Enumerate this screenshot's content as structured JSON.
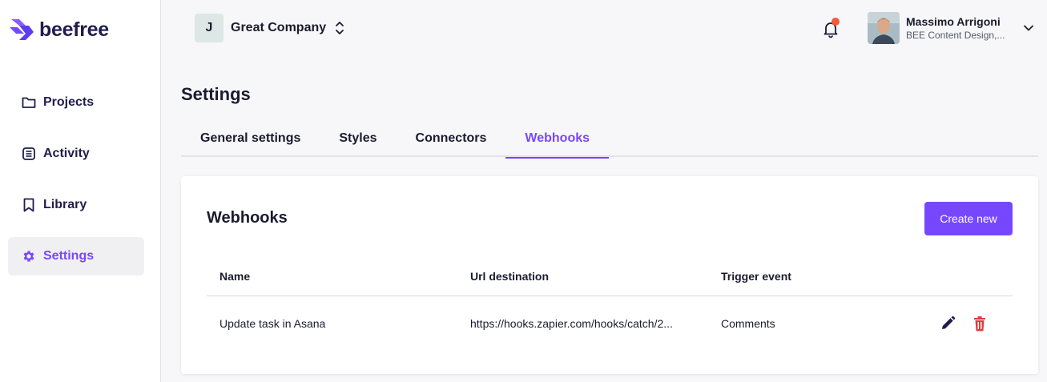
{
  "brand": {
    "name": "beefree"
  },
  "sidebar": {
    "items": [
      {
        "label": "Projects",
        "icon": "folder-icon",
        "active": false
      },
      {
        "label": "Activity",
        "icon": "activity-list-icon",
        "active": false
      },
      {
        "label": "Library",
        "icon": "bookmark-icon",
        "active": false
      },
      {
        "label": "Settings",
        "icon": "gear-icon",
        "active": true
      }
    ]
  },
  "header": {
    "company": {
      "initial": "J",
      "name": "Great Company"
    },
    "notifications": {
      "has_unread": true
    },
    "user": {
      "name": "Massimo Arrigoni",
      "org": "BEE Content Design,..."
    }
  },
  "page": {
    "title": "Settings",
    "tabs": [
      {
        "label": "General settings",
        "active": false
      },
      {
        "label": "Styles",
        "active": false
      },
      {
        "label": "Connectors",
        "active": false
      },
      {
        "label": "Webhooks",
        "active": true
      }
    ]
  },
  "webhooks": {
    "title": "Webhooks",
    "create_label": "Create new",
    "columns": [
      "Name",
      "Url destination",
      "Trigger event"
    ],
    "rows": [
      {
        "name": "Update task in Asana",
        "url": "https://hooks.zapier.com/hooks/catch/2...",
        "trigger": "Comments"
      }
    ]
  },
  "colors": {
    "accent": "#7747ff",
    "danger": "#e03a3e",
    "notification": "#f15a3b",
    "brand_dark": "#1f1d4d"
  }
}
